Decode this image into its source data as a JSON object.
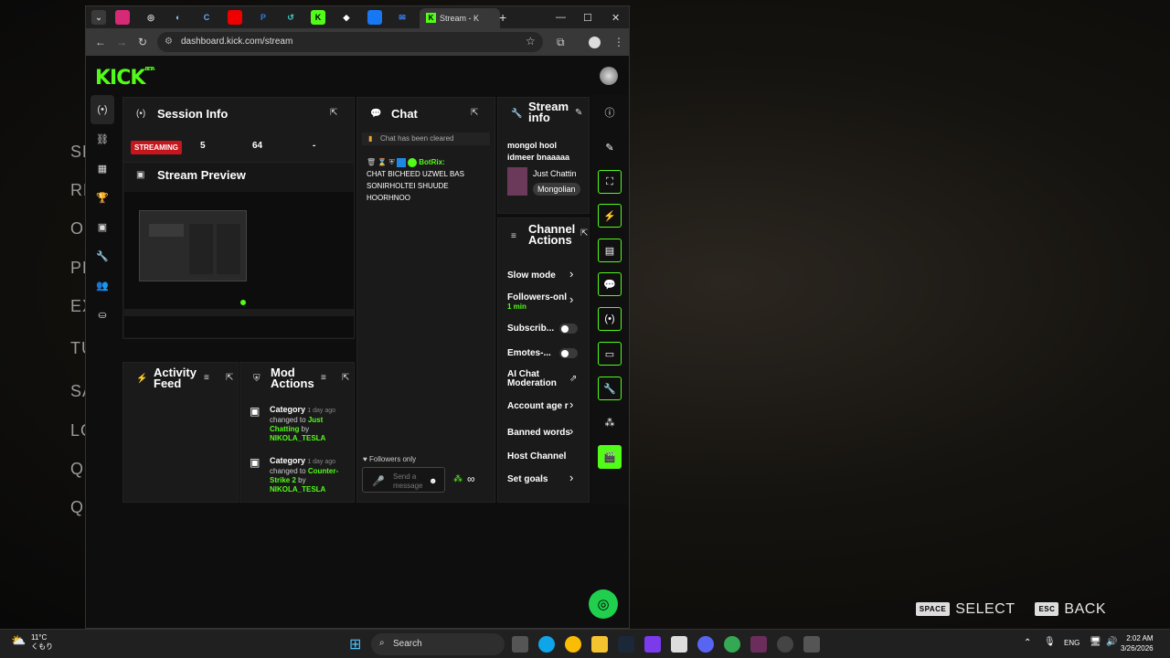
{
  "background_menu": [
    "SK",
    "RE",
    "OP",
    "PL",
    "EX",
    "TU",
    "SA",
    "LO",
    "QU",
    "QU"
  ],
  "hints": {
    "select_key": "SPACE",
    "select_label": "SELECT",
    "back_key": "ESC",
    "back_label": "BACK"
  },
  "browser": {
    "active_tab_title": "Stream - K",
    "new_tab": "+",
    "url": "dashboard.kick.com/stream"
  },
  "kick": {
    "logo": "KICK",
    "logo_badge": "BETA"
  },
  "session_info": {
    "title": "Session Info",
    "status": "STREAMING",
    "viewers": "5",
    "followers": "64",
    "duration": "-"
  },
  "stream_preview": {
    "title": "Stream Preview"
  },
  "activity_feed": {
    "title_line1": "Activity",
    "title_line2": "Feed"
  },
  "mod_actions": {
    "title_line1": "Mod",
    "title_line2": "Actions",
    "entries": [
      {
        "title": "Category",
        "time": "1 day ago",
        "text": "changed to",
        "value": "Just Chatting",
        "by": "by",
        "user": "NIKOLA_TESLA"
      },
      {
        "title": "Category",
        "time": "1 day ago",
        "text": "changed to",
        "value": "Counter-Strike 2",
        "by": "by",
        "user": "NIKOLA_TESLA"
      }
    ]
  },
  "chat": {
    "title": "Chat",
    "cleared": "Chat has been cleared",
    "username": "BotRix:",
    "message": "CHAT BICHEED UZWEL BAS SONIRHOLTEI SHUUDE HOORHNOO",
    "followers_only": "Followers only",
    "placeholder": "Send a message"
  },
  "stream_info": {
    "title_line1": "Stream",
    "title_line2": "info",
    "stream_title": "mongol hool idmeer bnaaaaa",
    "category": "Just Chattin",
    "tag": "Mongolian"
  },
  "channel_actions": {
    "title_line1": "Channel",
    "title_line2": "Actions",
    "slow_mode": "Slow mode",
    "followers_only": "Followers-onl",
    "followers_duration": "1 min",
    "subscribers": "Subscrib...",
    "emotes": "Emotes-...",
    "ai_chat_line1": "AI Chat",
    "ai_chat_line2": "Moderation",
    "account_age": "Account age r",
    "banned_words": "Banned words",
    "host_channel": "Host Channel",
    "set_goals": "Set goals"
  },
  "taskbar": {
    "weather_temp": "11°C",
    "weather_desc": "くもり",
    "search": "Search",
    "lang": "ENG",
    "time": "2:02 AM",
    "date": "3/26/2026"
  }
}
